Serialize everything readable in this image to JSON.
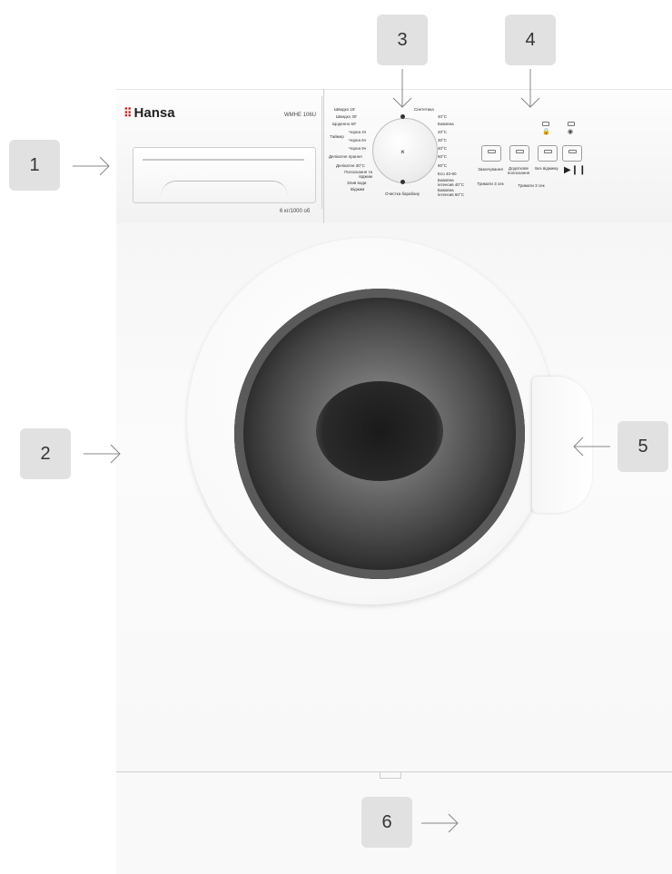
{
  "brand": {
    "logo_text": "Hansa",
    "model": "WMHE 106U",
    "capacity": "6 кг/1000 об"
  },
  "callouts": [
    "1",
    "2",
    "3",
    "4",
    "5",
    "6"
  ],
  "programs_left": [
    "Швидко 15'",
    "Швидко 30'",
    "Щоденно 60'",
    "Чорна 3ч",
    "Чорна 6ч",
    "Чорна 9ч",
    "Делікатне прання",
    "Делікатне 30°С",
    "Полоскання та віджим",
    "Злив води",
    "Віджим"
  ],
  "programs_right": [
    "Синтетика",
    "40°С",
    "Бавовна",
    "20°С",
    "30°С",
    "40°С",
    "60°С",
    "90°С",
    "Eco 40-60",
    "Бавовна інтенсив 40°С",
    "Бавовна інтенсив 60°С"
  ],
  "program_bottom": "Очистка барабану",
  "timer_label": "Таймер",
  "buttons": [
    {
      "label": "Замочування"
    },
    {
      "label": "Додаткове полоскання"
    },
    {
      "label": "Без віджиму"
    },
    {
      "label": ""
    }
  ],
  "button_sublabels": [
    "Тримати 3 сек",
    "Тримати 3 сек"
  ]
}
